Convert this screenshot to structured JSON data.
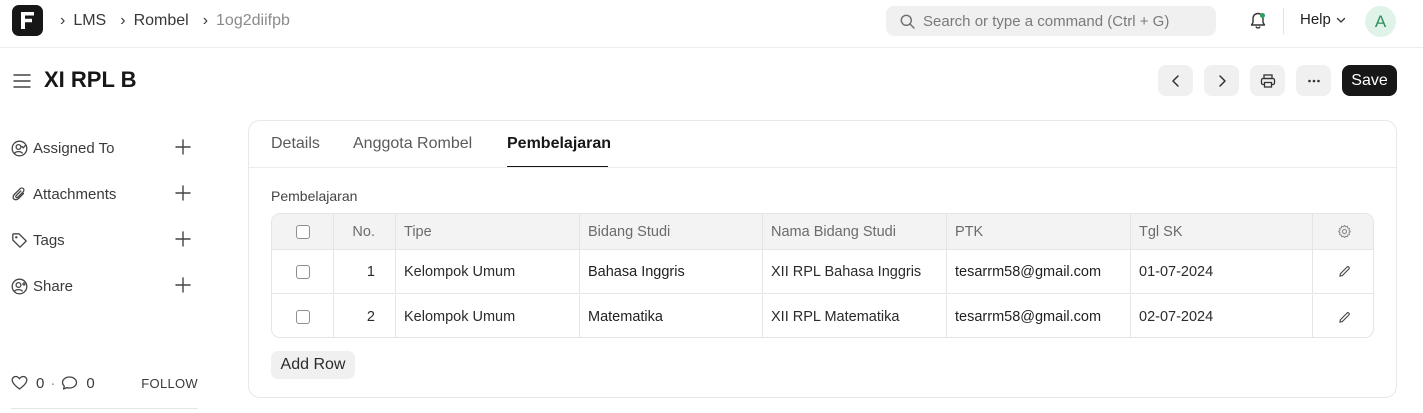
{
  "navbar": {
    "breadcrumbs": [
      "LMS",
      "Rombel",
      "1og2diifpb"
    ],
    "search_placeholder": "Search or type a command (Ctrl + G)",
    "help_label": "Help",
    "avatar_initial": "A"
  },
  "page": {
    "title": "XI RPL B",
    "save_label": "Save"
  },
  "sidebar": {
    "items": [
      {
        "label": "Assigned To",
        "icon": "user-check-icon"
      },
      {
        "label": "Attachments",
        "icon": "paperclip-icon"
      },
      {
        "label": "Tags",
        "icon": "tag-icon"
      },
      {
        "label": "Share",
        "icon": "share-user-icon"
      }
    ],
    "likes_count": "0",
    "comments_count": "0",
    "follow_label": "FOLLOW"
  },
  "tabs": [
    {
      "label": "Details",
      "active": false
    },
    {
      "label": "Anggota Rombel",
      "active": false
    },
    {
      "label": "Pembelajaran",
      "active": true
    }
  ],
  "section": {
    "label": "Pembelajaran"
  },
  "table": {
    "headers": {
      "no": "No.",
      "tipe": "Tipe",
      "bidang_studi": "Bidang Studi",
      "nama_bidang_studi": "Nama Bidang Studi",
      "ptk": "PTK",
      "tgl_sk": "Tgl SK"
    },
    "rows": [
      {
        "no": "1",
        "tipe": "Kelompok Umum",
        "bidang_studi": "Bahasa Inggris",
        "nama_bidang_studi": "XII RPL Bahasa Inggris",
        "ptk": "tesarrm58@gmail.com",
        "tgl_sk": "01-07-2024"
      },
      {
        "no": "2",
        "tipe": "Kelompok Umum",
        "bidang_studi": "Matematika",
        "nama_bidang_studi": "XII RPL Matematika",
        "ptk": "tesarrm58@gmail.com",
        "tgl_sk": "02-07-2024"
      }
    ],
    "add_row_label": "Add Row"
  },
  "colors": {
    "primary": "#171717",
    "button_bg": "#f0f0f0",
    "border": "#e5e5e5",
    "avatar_bg": "#dff3e8",
    "avatar_fg": "#2f8f5e"
  }
}
